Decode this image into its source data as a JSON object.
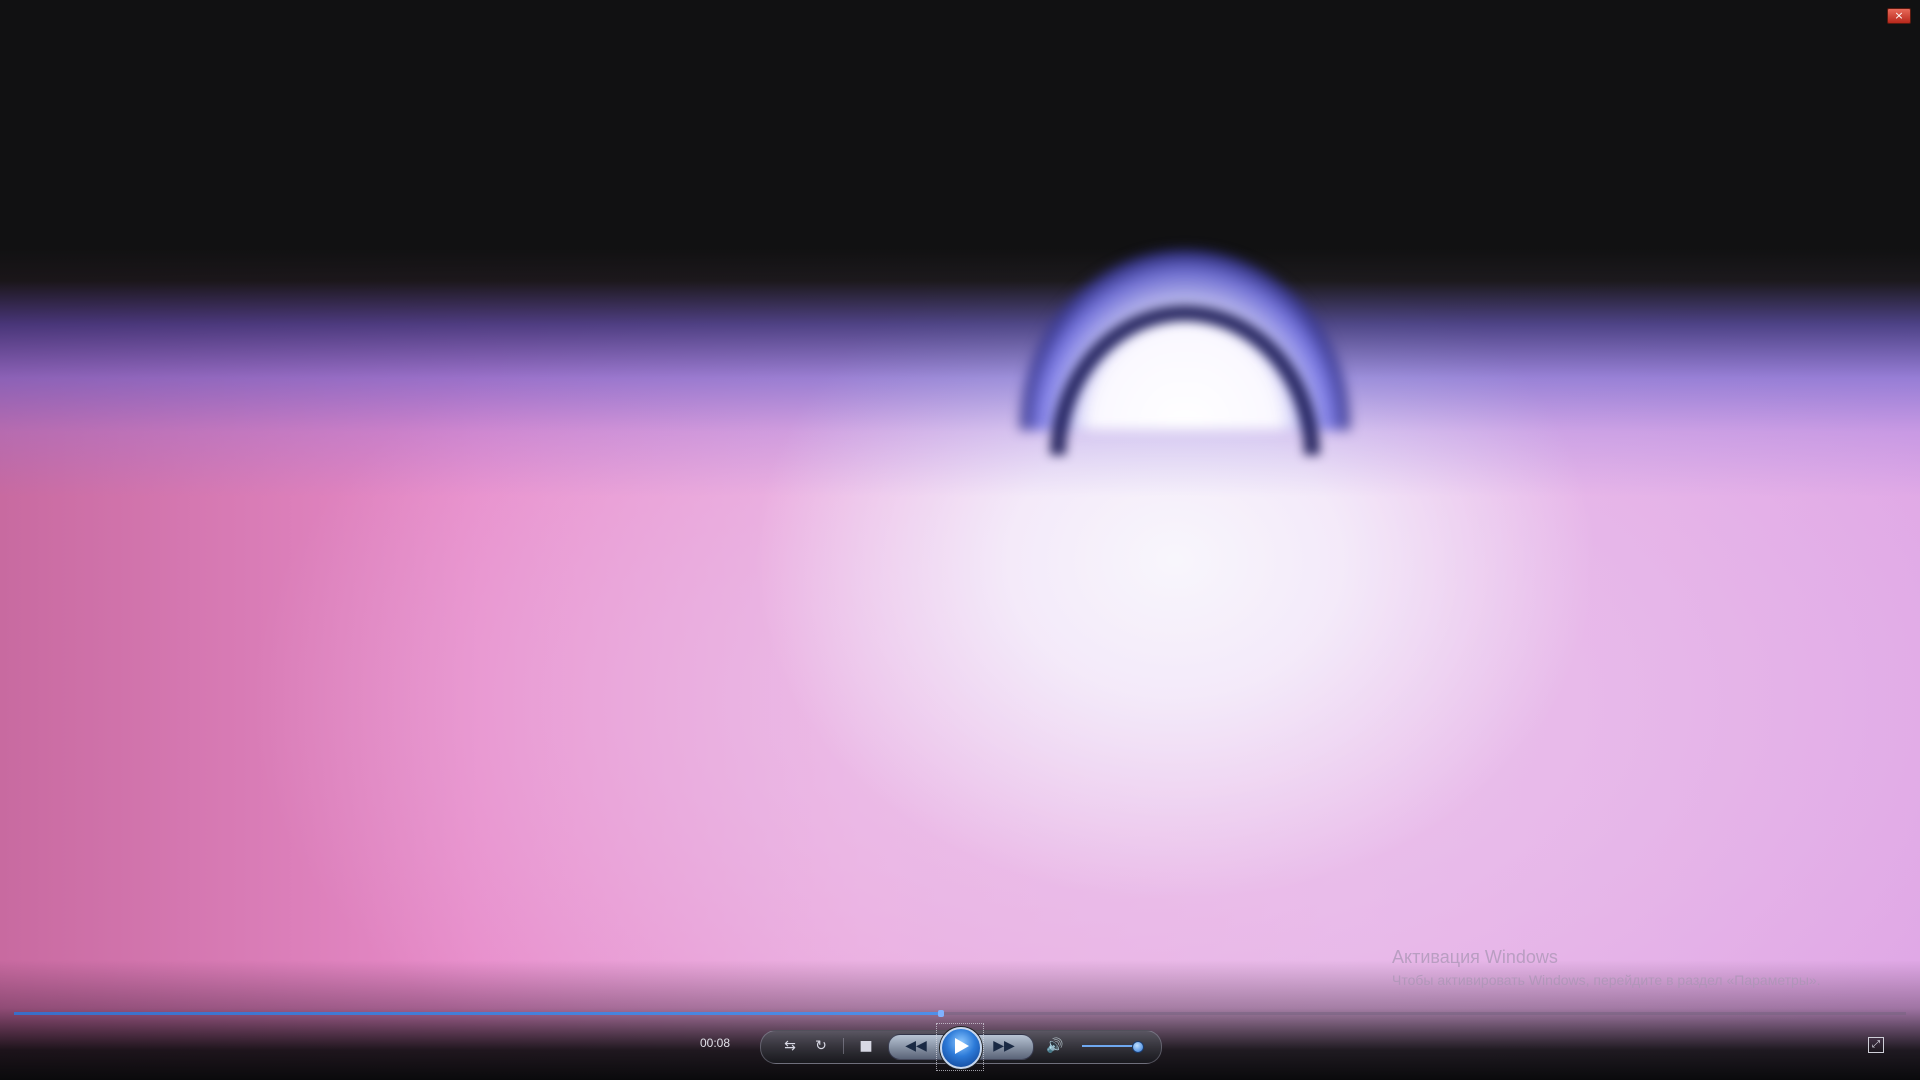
{
  "window": {
    "close_icon": "×"
  },
  "watermark": {
    "title": "Активация Windows",
    "subtitle": "Чтобы активировать Windows, перейдите в раздел «Параметры»."
  },
  "playback": {
    "elapsed": "00:08",
    "progress_fraction": 0.49,
    "volume_fraction": 0.92
  },
  "controls": {
    "shuffle_icon": "⇆",
    "repeat_icon": "↻",
    "stop_icon": "■",
    "previous_icon": "◀◀",
    "next_icon": "▶▶",
    "volume_icon": "🔊",
    "fullscreen_icon": "⤢"
  }
}
